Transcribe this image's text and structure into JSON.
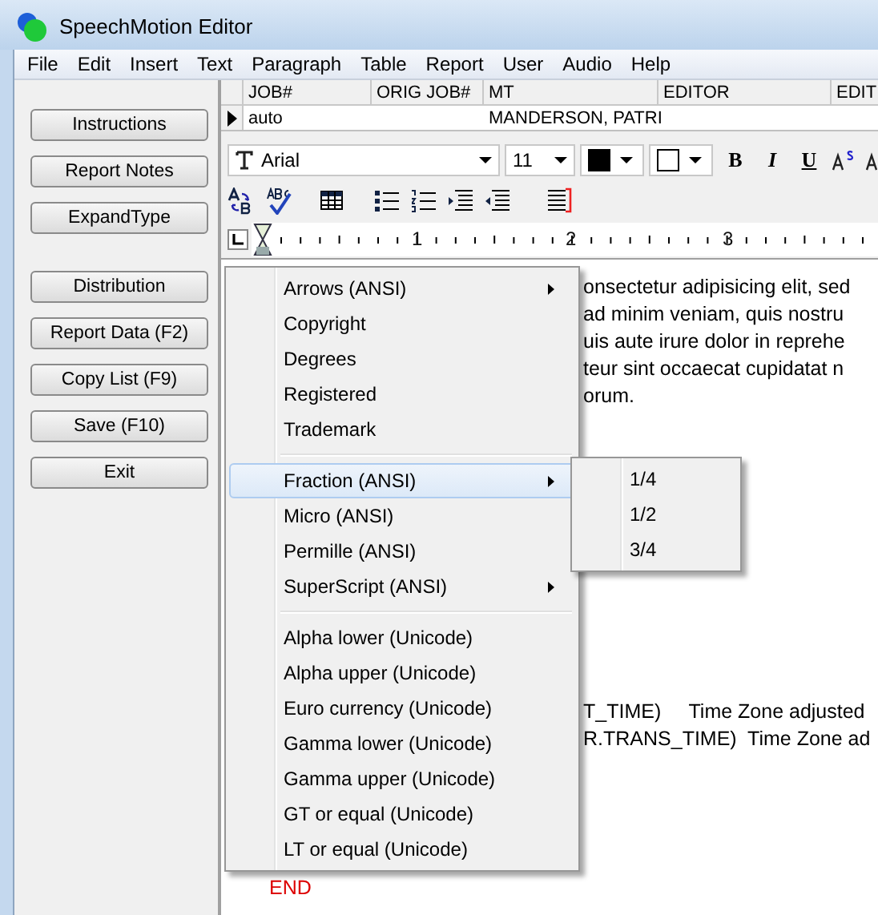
{
  "window": {
    "title": "SpeechMotion Editor"
  },
  "menu_bar": [
    "File",
    "Edit",
    "Insert",
    "Text",
    "Paragraph",
    "Table",
    "Report",
    "User",
    "Audio",
    "Help"
  ],
  "side_button_groups": [
    [
      "Instructions",
      "Report Notes",
      "ExpandType"
    ],
    [
      "Distribution",
      "Report Data (F2)",
      "Copy List (F9)",
      "Save (F10)",
      "Exit"
    ]
  ],
  "job_grid": {
    "columns": [
      "JOB#",
      "ORIG JOB#",
      "MT",
      "EDITOR",
      "EDIT"
    ],
    "rows": [
      {
        "cells": [
          "auto",
          "",
          "MANDERSON, PATRI",
          "",
          ""
        ],
        "current": true
      }
    ]
  },
  "format_toolbar": {
    "font": "Arial",
    "size": "11",
    "buttons": [
      "B",
      "I",
      "U"
    ]
  },
  "ruler": {
    "marks": [
      "1",
      "2",
      "3"
    ]
  },
  "document": {
    "blocks": [
      {
        "kind": "text",
        "lines": [
          "onsectetur adipisicing elit, sed",
          "ad minim veniam, quis nostru",
          "uis aute irure dolor in reprehe",
          "teur sint occaecat cupidatat n",
          "orum."
        ]
      },
      {
        "kind": "text",
        "lines": [
          "T_TIME)     Time Zone adjusted",
          "R.TRANS_TIME)  Time Zone ad"
        ]
      },
      {
        "kind": "keyword",
        "lines": [
          "END"
        ]
      }
    ]
  },
  "context_menu": {
    "items": [
      {
        "kind": "item",
        "label": "Arrows (ANSI)",
        "submenu": true,
        "selected": false
      },
      {
        "kind": "item",
        "label": "Copyright",
        "submenu": false,
        "selected": false
      },
      {
        "kind": "item",
        "label": "Degrees",
        "submenu": false,
        "selected": false
      },
      {
        "kind": "item",
        "label": "Registered",
        "submenu": false,
        "selected": false
      },
      {
        "kind": "item",
        "label": "Trademark",
        "submenu": false,
        "selected": false
      },
      {
        "kind": "separator"
      },
      {
        "kind": "item",
        "label": "Fraction (ANSI)",
        "submenu": true,
        "selected": true
      },
      {
        "kind": "item",
        "label": "Micro (ANSI)",
        "submenu": false,
        "selected": false
      },
      {
        "kind": "item",
        "label": "Permille (ANSI)",
        "submenu": false,
        "selected": false
      },
      {
        "kind": "item",
        "label": "SuperScript (ANSI)",
        "submenu": true,
        "selected": false
      },
      {
        "kind": "separator"
      },
      {
        "kind": "item",
        "label": "Alpha lower (Unicode)",
        "submenu": false,
        "selected": false
      },
      {
        "kind": "item",
        "label": "Alpha upper (Unicode)",
        "submenu": false,
        "selected": false
      },
      {
        "kind": "item",
        "label": "Euro currency (Unicode)",
        "submenu": false,
        "selected": false
      },
      {
        "kind": "item",
        "label": "Gamma lower (Unicode)",
        "submenu": false,
        "selected": false
      },
      {
        "kind": "item",
        "label": "Gamma upper (Unicode)",
        "submenu": false,
        "selected": false
      },
      {
        "kind": "item",
        "label": "GT or equal (Unicode)",
        "submenu": false,
        "selected": false
      },
      {
        "kind": "item",
        "label": "LT or equal (Unicode)",
        "submenu": false,
        "selected": false
      }
    ]
  },
  "submenu": {
    "items": [
      {
        "label": "1/4",
        "selected": false
      },
      {
        "label": "1/2",
        "selected": false
      },
      {
        "label": "3/4",
        "selected": false
      }
    ]
  }
}
